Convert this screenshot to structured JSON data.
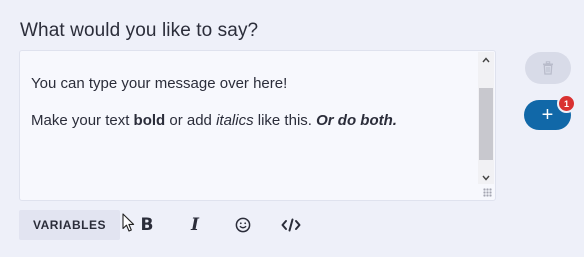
{
  "heading": "What would you like to say?",
  "editor": {
    "line1": "You can type your message over here!",
    "line2": {
      "part1": "Make your text ",
      "bold": "bold",
      "part2": " or add ",
      "italic": "italics",
      "part3": " like this. ",
      "bold_italic": "Or do both."
    }
  },
  "toolbar": {
    "variables_label": "VARIABLES",
    "bold_glyph": "B",
    "italic_glyph": "I",
    "emoji_glyph": "☺",
    "code_glyph": "</>"
  },
  "actions": {
    "add_glyph": "+",
    "badge_count": "1"
  },
  "colors": {
    "background": "#eef0f9",
    "accent": "#1168a8",
    "badge": "#d93131"
  },
  "icons": {
    "delete": "trash-icon",
    "add": "plus-icon",
    "emoji": "smiley-icon",
    "code": "code-icon"
  }
}
